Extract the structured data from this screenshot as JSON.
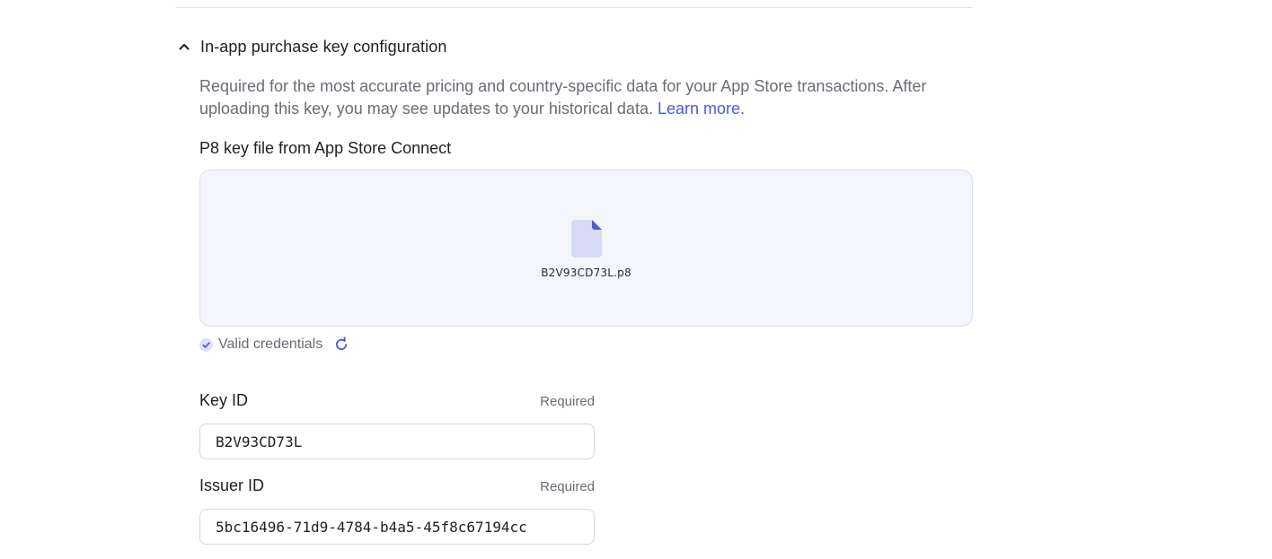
{
  "section": {
    "title": "In-app purchase key configuration",
    "description": "Required for the most accurate pricing and country-specific data for your App Store transactions. After uploading this key, you may see updates to your historical data.",
    "learn_more": "Learn more."
  },
  "p8": {
    "label": "P8 key file from App Store Connect",
    "file_name": "B2V93CD73L.p8",
    "status": "Valid credentials"
  },
  "key_id": {
    "label": "Key ID",
    "required": "Required",
    "value": "B2V93CD73L"
  },
  "issuer_id": {
    "label": "Issuer ID",
    "required": "Required",
    "value": "5bc16496-71d9-4784-b4a5-45f8c67194cc"
  },
  "colors": {
    "accent": "#4a5bd0",
    "muted_text": "#6b6c75",
    "dropzone_bg": "#f5f6fc"
  },
  "icons": [
    "chevron-up-icon",
    "file-icon",
    "check-circle-icon",
    "refresh-icon"
  ]
}
